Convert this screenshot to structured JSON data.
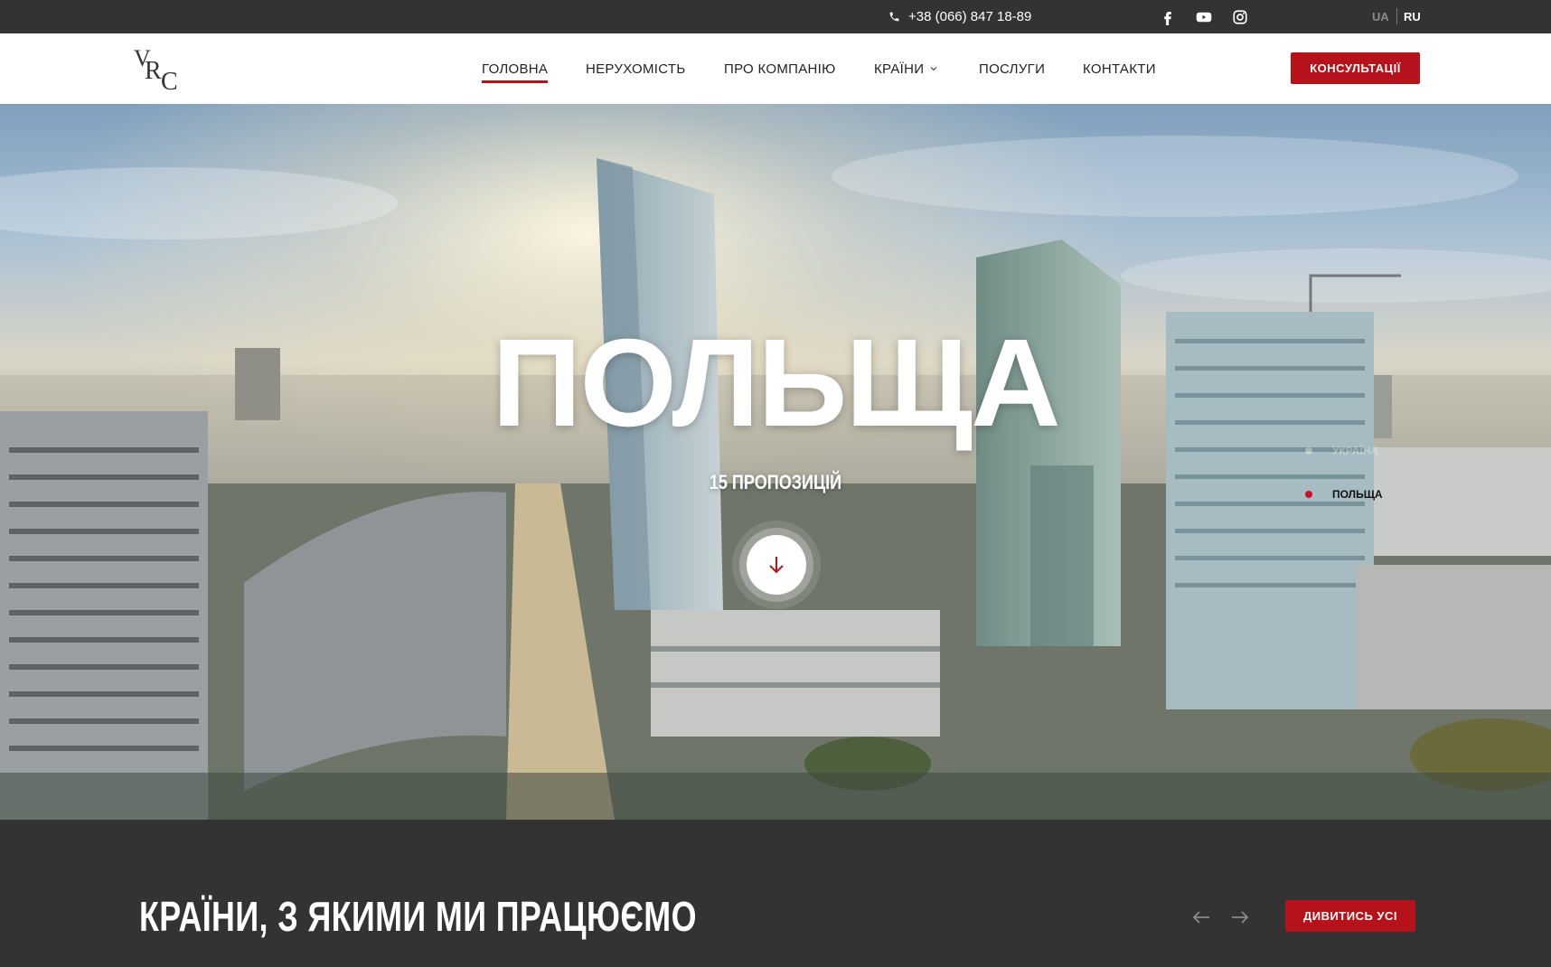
{
  "topbar": {
    "phone": "+38 (066) 847 18-89",
    "social": [
      "facebook-icon",
      "youtube-icon",
      "instagram-icon"
    ],
    "languages": [
      "UA",
      "RU"
    ],
    "active_language": "RU"
  },
  "header": {
    "logo_icon": "vrc-logo-icon",
    "nav": [
      {
        "label": "ГОЛОВНА",
        "active": true
      },
      {
        "label": "НЕРУХОМІСТЬ",
        "active": false
      },
      {
        "label": "ПРО КОМПАНІЮ",
        "active": false
      },
      {
        "label": "КРАЇНИ",
        "active": false,
        "has_dropdown": true
      },
      {
        "label": "ПОСЛУГИ",
        "active": false
      },
      {
        "label": "КОНТАКТИ",
        "active": false
      }
    ],
    "cta_label": "КОНСУЛЬТАЦІЇ"
  },
  "hero": {
    "title": "ПОЛЬЩА",
    "subtitle": "15 ПРОПОЗИЦІЙ",
    "slides": [
      {
        "label": "УКРАЇНА",
        "active": false
      },
      {
        "label": "ПОЛЬЩА",
        "active": true
      }
    ]
  },
  "section": {
    "title": "КРАЇНИ, З ЯКИМИ МИ ПРАЦЮЄМО",
    "view_all_label": "ДИВИТИСЬ УСІ"
  },
  "colors": {
    "accent": "#b5121b",
    "dark_bg": "#333333",
    "header_bg": "#ffffff"
  }
}
